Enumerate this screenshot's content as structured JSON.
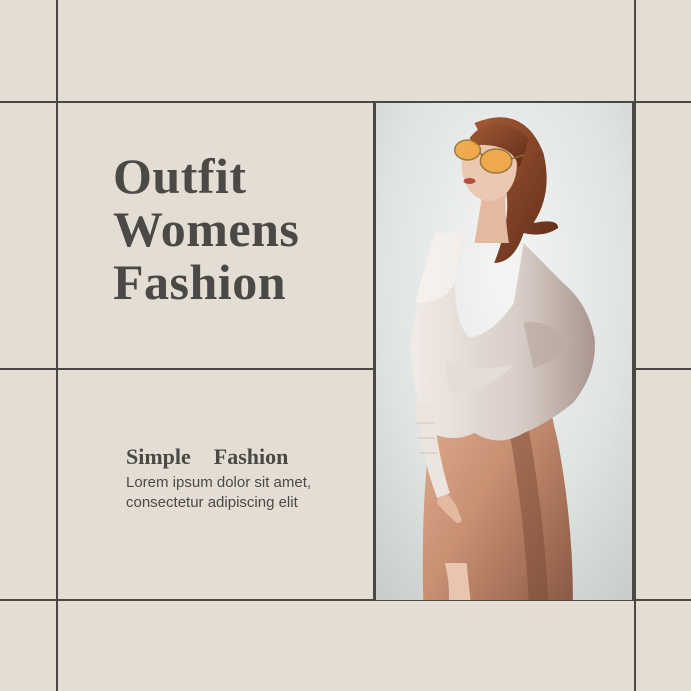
{
  "title": {
    "line1": "Outfit",
    "line2": "Womens",
    "line3": "Fashion"
  },
  "subtitle": "Simple  Fashion",
  "body_text": "Lorem ipsum dolor sit amet, consectetur adipiscing elit",
  "colors": {
    "background": "#e4ddd3",
    "grid_lines": "#4a4744",
    "text": "#4b4946"
  },
  "photo": {
    "subject": "woman-in-orange-sunglasses-oversized-white-shirt-and-peach-dress"
  }
}
